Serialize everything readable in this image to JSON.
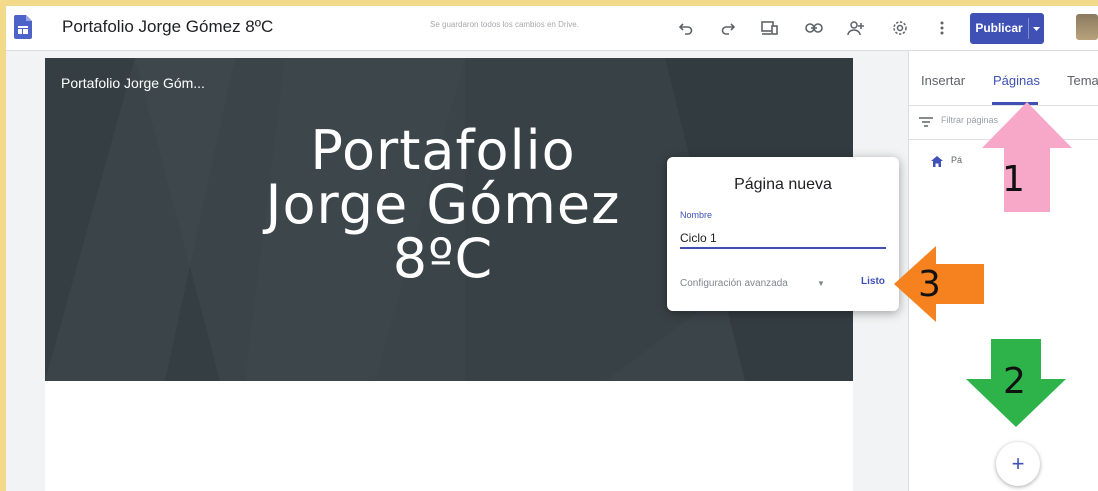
{
  "topbar": {
    "title": "Portafolio Jorge Gómez 8ºC",
    "save_status": "Se guardaron todos los cambios en Drive.",
    "publish_label": "Publicar",
    "icons": [
      "undo-icon",
      "redo-icon",
      "preview-icon",
      "link-icon",
      "share-icon",
      "settings-icon",
      "more-icon"
    ]
  },
  "hero": {
    "small_title": "Portafolio Jorge Góm...",
    "title_lines": [
      "Portafolio",
      "Jorge Gómez",
      "8ºC"
    ]
  },
  "panel": {
    "tabs": [
      {
        "label": "Insertar",
        "active": false
      },
      {
        "label": "Páginas",
        "active": true
      },
      {
        "label": "Tema",
        "active": false
      }
    ],
    "filter_placeholder": "Filtrar páginas",
    "page_item_label": "Pá",
    "add_label": "+"
  },
  "dialog": {
    "title": "Página nueva",
    "field_label": "Nombre",
    "field_value": "Ciclo 1",
    "advanced_label": "Configuración avanzada",
    "done_label": "Listo"
  },
  "annotations": [
    {
      "number": "1",
      "color": "#f7a8c8"
    },
    {
      "number": "2",
      "color": "#2db34a"
    },
    {
      "number": "3",
      "color": "#f5821f"
    }
  ],
  "colors": {
    "accent": "#3f51b5",
    "hero_bg": "#3b4449",
    "frame": "#f3d98a"
  }
}
